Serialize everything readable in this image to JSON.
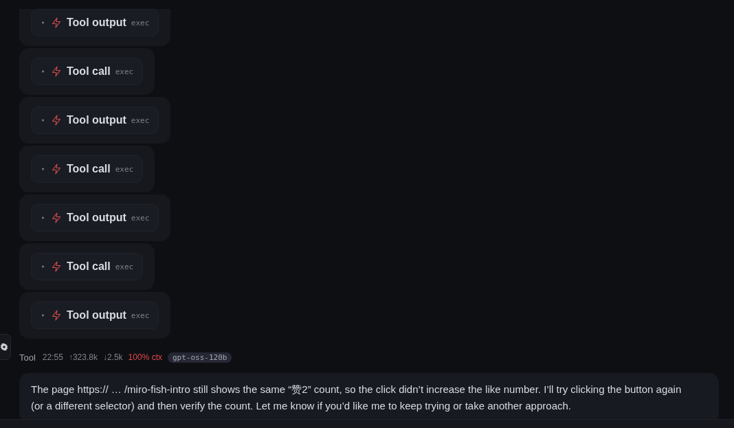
{
  "tool_events": [
    {
      "label": "Tool output",
      "tag": "exec",
      "expanded": false
    },
    {
      "label": "Tool call",
      "tag": "exec",
      "expanded": false
    },
    {
      "label": "Tool output",
      "tag": "exec",
      "expanded": false
    },
    {
      "label": "Tool call",
      "tag": "exec",
      "expanded": false
    },
    {
      "label": "Tool output",
      "tag": "exec",
      "expanded": false
    },
    {
      "label": "Tool call",
      "tag": "exec",
      "expanded": false
    },
    {
      "label": "Tool output",
      "tag": "exec",
      "expanded": false
    }
  ],
  "meta": {
    "author": "Tool",
    "time": "22:55",
    "tokens_in": "↑323.8k",
    "tokens_out": "↓2.5k",
    "context": "100% ctx",
    "context_warning": true,
    "model": "gpt-oss-120b"
  },
  "message": {
    "text": "The page https:// … /miro-fish-intro still shows the same “赞2” count, so the click didn’t increase the like number. I’ll try clicking the button again (or a different selector) and then verify the count. Let me know if you’d like me to keep trying or take another approach."
  }
}
